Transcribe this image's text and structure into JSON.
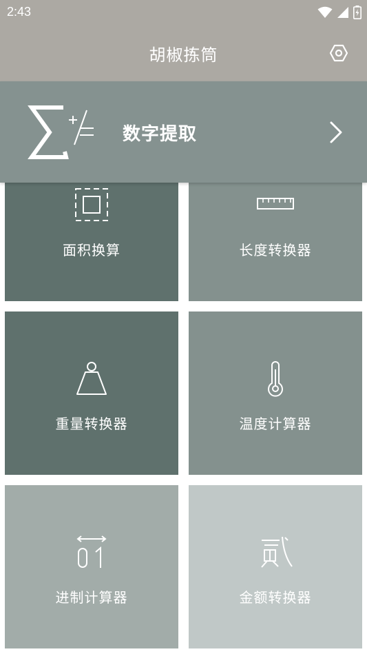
{
  "status_bar": {
    "time": "2:43",
    "icons": [
      "wifi-icon",
      "signal-icon",
      "battery-charging-icon"
    ]
  },
  "app_bar": {
    "title": "胡椒拣筒",
    "settings_icon": "settings-hex-icon"
  },
  "banner": {
    "label": "数字提取",
    "icon": "sigma-math-icon",
    "chevron_icon": "chevron-right-icon"
  },
  "tiles": [
    {
      "label": "面积换算",
      "icon": "area-icon",
      "color": "#5f716d"
    },
    {
      "label": "长度转换器",
      "icon": "ruler-icon",
      "color": "#84918e"
    },
    {
      "label": "重量转换器",
      "icon": "weight-icon",
      "color": "#5f716d"
    },
    {
      "label": "温度计算器",
      "icon": "thermometer-icon",
      "color": "#84918e"
    },
    {
      "label": "进制计算器",
      "icon": "binary-icon",
      "color": "#a2aca9"
    },
    {
      "label": "金额转换器",
      "icon": "yuan-icon",
      "color": "#c0c8c7"
    }
  ],
  "colors": {
    "header": "#aca9a3",
    "banner": "#859290",
    "white": "#ffffff"
  }
}
